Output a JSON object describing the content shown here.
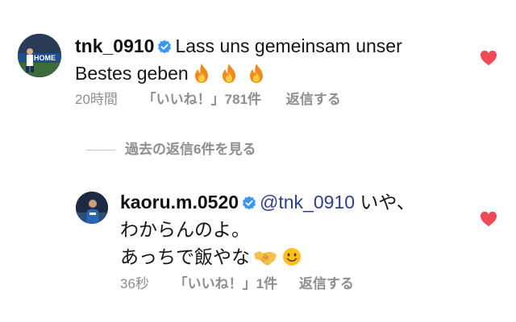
{
  "comments": [
    {
      "username": "tnk_0910",
      "text_line1": "Lass uns gemeinsam unser",
      "text_line2": "Bestes geben",
      "time": "20時間",
      "likes": "「いいね！」781件",
      "reply_label": "返信する",
      "emojis": [
        "fire-emoji",
        "fire-emoji",
        "fire-emoji"
      ]
    }
  ],
  "view_replies": {
    "label": "過去の返信6件を見る"
  },
  "replies": [
    {
      "username": "kaoru.m.0520",
      "mention": "@tnk_0910",
      "text_line1_rest": " いや、",
      "text_line2": "わからんのよ。",
      "text_line3": "あっちで飯やな",
      "time": "36秒",
      "likes": "「いいね！」1件",
      "reply_label": "返信する",
      "emojis": [
        "handshake-emoji",
        "smiling-face-emoji"
      ]
    }
  ],
  "colors": {
    "heart": "#ed4956",
    "verified": "#3897f0",
    "meta_text": "#8e8e8e",
    "mention": "#2f3f8f"
  }
}
